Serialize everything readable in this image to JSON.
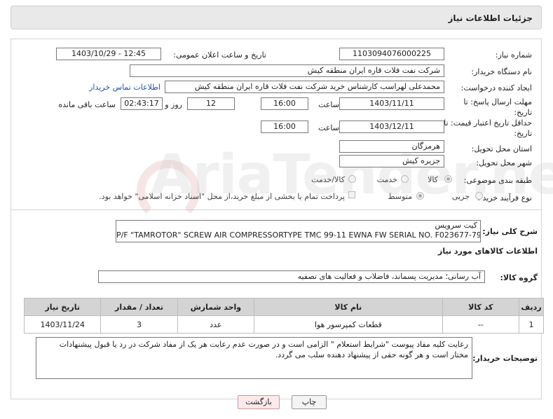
{
  "header": {
    "title": "جزئیات اطلاعات نیاز"
  },
  "fields": {
    "need_number_label": "شماره نیاز:",
    "need_number": "1103094076000225",
    "announce_label": "تاریخ و ساعت اعلان عمومی:",
    "announce_value": "1403/10/29 - 12:45",
    "buyer_label": "نام دستگاه خریدار:",
    "buyer_value": "شرکت نفت فلات قاره ایران منطقه کیش",
    "creator_label": "ایجاد کننده درخواست:",
    "creator_value": "محمدعلی لهراسب کارشناس خرید شرکت نفت فلات قاره ایران منطقه کیش",
    "contact_link": "اطلاعات تماس خریدار",
    "deadline_label": "مهلت ارسال پاسخ: تا تاریخ:",
    "deadline_date": "1403/11/11",
    "time_label": "ساعت",
    "deadline_time": "16:00",
    "days_value": "12",
    "days_label": "روز و",
    "remaining_time": "02:43:17",
    "remaining_label": "ساعت باقی مانده",
    "validity_label": "حداقل تاریخ اعتبار قیمت: تا تاریخ:",
    "validity_date": "1403/12/11",
    "validity_time": "16:00",
    "province_label": "استان محل تحویل:",
    "province_value": "هرمزگان",
    "city_label": "شهر محل تحویل:",
    "city_value": "جزیره کیش",
    "category_label": "طبقه بندی موضوعی:",
    "category_options": [
      "کالا",
      "خدمت",
      "کالا/خدمت"
    ],
    "process_label": "نوع فرآیند خرید :",
    "process_options": [
      "جزیی",
      "متوسط"
    ],
    "payment_note": "پرداخت تمام یا بخشی از مبلغ خرید،از محل \"اسناد خزانه اسلامی\" خواهد بود."
  },
  "summary": {
    "label": "شرح کلی نیاز:",
    "line1": "کیت سرویس",
    "line2": "P/F \"TAMROTOR\" SCREW AIR COMPRESSORTYPE TMC 99-11 EWNA FW SERIAL NO. F023677-79"
  },
  "goods": {
    "section_title": "اطلاعات کالاهای مورد نیاز",
    "group_label": "گروه کالا:",
    "group_value": "آب رسانی؛ مدیریت پسماند، فاضلاب و فعالیت های تصفیه",
    "columns": [
      "ردیف",
      "کد کالا",
      "نام کالا",
      "واحد شمارش",
      "تعداد / مقدار",
      "تاریخ نیاز"
    ],
    "rows": [
      {
        "index": "1",
        "code": "--",
        "name": "قطعات کمپرسور هوا",
        "unit": "عدد",
        "qty": "3",
        "date": "1403/11/24"
      }
    ]
  },
  "buyer_notes": {
    "label": "توضیحات خریدار:",
    "text": "رعایت کلیه مفاد  پیوست \"شرایط استعلام \" الزامی است و در صورت عدم رعایت هر یک از مفاد شرکت در رد یا قبول پیشنهادات مختار است  و هر گونه حقی از پیشنهاد دهنده سلب می گردد."
  },
  "buttons": {
    "print": "چاپ",
    "back": "بازگشت"
  },
  "watermark": "AriaTender.neT"
}
